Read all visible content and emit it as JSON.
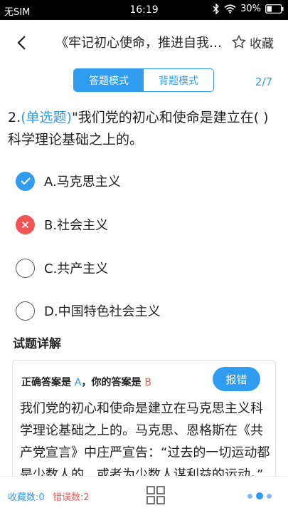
{
  "status_bar": {
    "carrier": "无SIM",
    "time": "16:19",
    "battery": "30%"
  },
  "nav": {
    "title": "《牢记初心使命，推进自我革命》",
    "favorite_label": "收藏"
  },
  "mode_toggle": {
    "answer_mode": "答题模式",
    "memorize_mode": "背题模式",
    "active": "answer_mode"
  },
  "page_counter": "2/7",
  "question": {
    "number": "2.",
    "type": "(单选题)",
    "text": "\"我们党的初心和使命是建立在(  )科学理论基础之上的。"
  },
  "options": [
    {
      "label": "A.马克思主义",
      "state": "correct"
    },
    {
      "label": "B.社会主义",
      "state": "wrong"
    },
    {
      "label": "C.共产主义",
      "state": "none"
    },
    {
      "label": "D.中国特色社会主义",
      "state": "none"
    }
  ],
  "detail": {
    "heading": "试题详解",
    "correct_prefix": "正确答案是",
    "correct_answer": "A",
    "separator": "，",
    "user_prefix": "你的答案是",
    "user_answer": "B",
    "report_label": "报错",
    "explanation": "我们党的初心和使命是建立在马克思主义科学理论基础之上的。马克思、恩格斯在《共产党宣言》中庄严宣告：“过去的一切运动都是少数人的，或者为少数人谋利益的运动。”"
  },
  "bottom_bar": {
    "favorites_count": "收藏数:0",
    "errors_count": "错误数:2"
  },
  "colors": {
    "accent": "#2f9cf0",
    "error": "#f05555"
  }
}
